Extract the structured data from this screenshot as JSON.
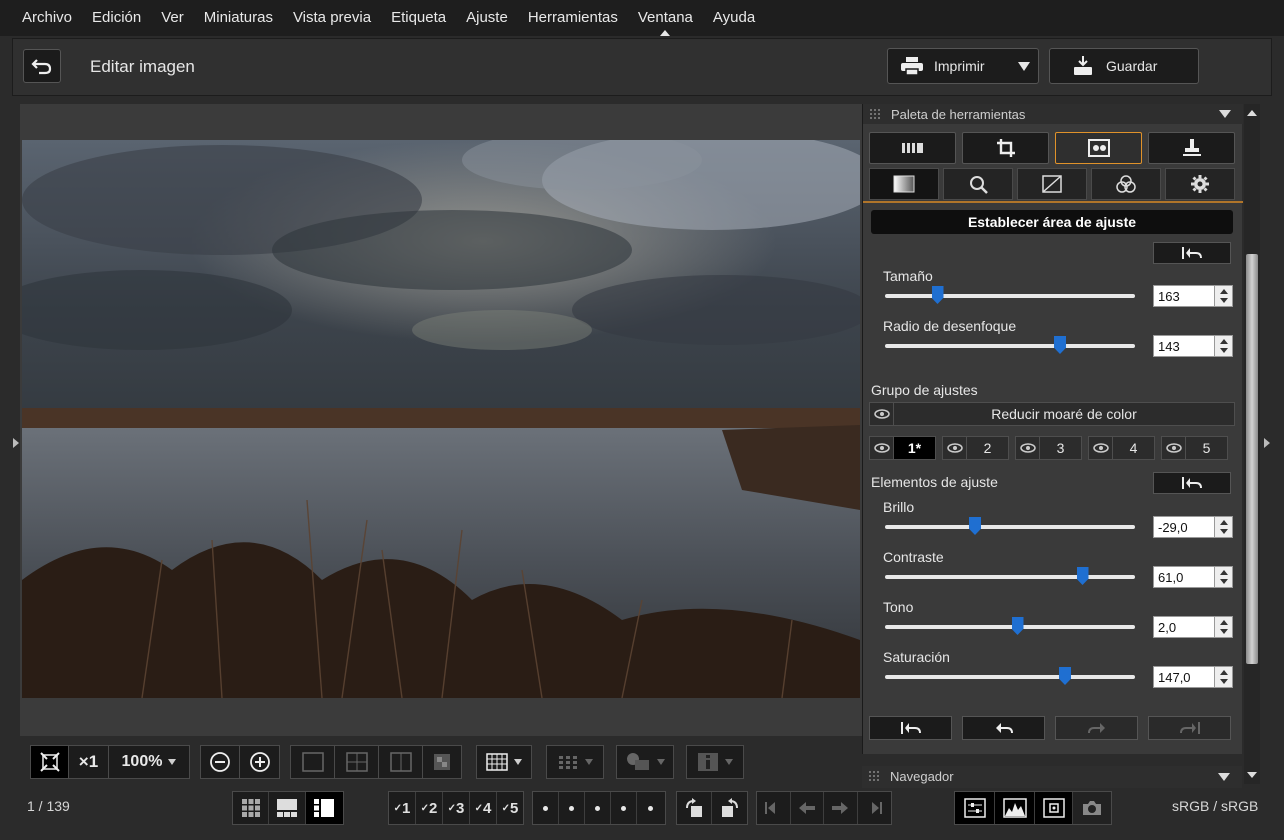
{
  "menu": [
    "Archivo",
    "Edición",
    "Ver",
    "Miniaturas",
    "Vista previa",
    "Etiqueta",
    "Ajuste",
    "Herramientas",
    "Ventana",
    "Ayuda"
  ],
  "toolbar": {
    "title": "Editar imagen",
    "print_label": "Imprimir",
    "save_label": "Guardar"
  },
  "image_toolbar": {
    "zoom_times": "×1",
    "zoom_percent": "100%"
  },
  "palette": {
    "title": "Paleta de herramientas",
    "section_title": "Establecer área de ajuste",
    "area": {
      "size_label": "Tamaño",
      "size_value": "163",
      "size_fraction": 0.21,
      "blur_label": "Radio de desenfoque",
      "blur_value": "143",
      "blur_fraction": 0.7
    },
    "group_label": "Grupo de ajustes",
    "group_name": "Reducir moaré de color",
    "group_numbers": [
      "1*",
      "2",
      "3",
      "4",
      "5"
    ],
    "elements_label": "Elementos de ajuste",
    "elements": [
      {
        "label": "Brillo",
        "value": "-29,0",
        "fraction": 0.36
      },
      {
        "label": "Contraste",
        "value": "61,0",
        "fraction": 0.79
      },
      {
        "label": "Tono",
        "value": "2,0",
        "fraction": 0.53
      },
      {
        "label": "Saturación",
        "value": "147,0",
        "fraction": 0.72
      }
    ]
  },
  "navigator_title": "Navegador",
  "status": {
    "counter": "1 / 139",
    "ratings": [
      "1",
      "2",
      "3",
      "4",
      "5"
    ],
    "colorspace": "sRGB / sRGB"
  }
}
